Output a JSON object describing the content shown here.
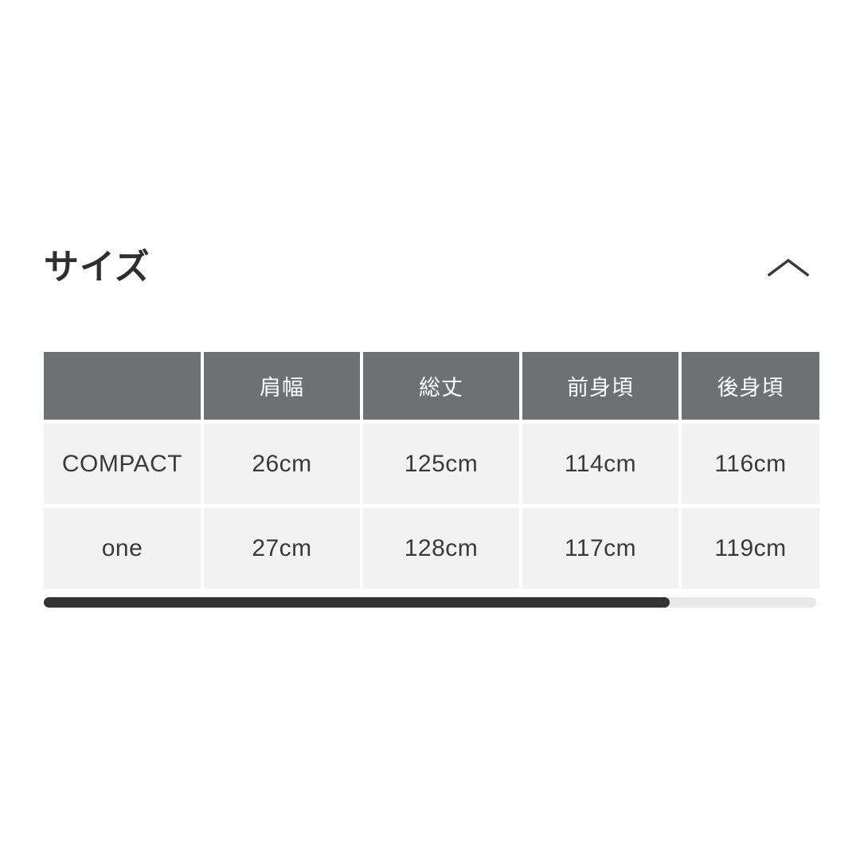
{
  "section": {
    "title": "サイズ",
    "toggle_icon": "chevron-up-icon",
    "expanded": true
  },
  "colors": {
    "page_background": "#ffffff",
    "header_cell_background": "#6f7071",
    "header_cell_text": "#ffffff",
    "body_cell_background": "#f2f2f2",
    "body_cell_text": "#3a3a3a",
    "title_text": "#2e2e2e",
    "scrollbar_track": "#e8e8e8",
    "scrollbar_thumb": "#333333"
  },
  "size_table": {
    "columns": [
      "",
      "肩幅",
      "総丈",
      "前身頃",
      "後身頃"
    ],
    "rows": [
      {
        "size": "COMPACT",
        "values": [
          "26cm",
          "125cm",
          "114cm",
          "116cm"
        ]
      },
      {
        "size": "one",
        "values": [
          "27cm",
          "128cm",
          "117cm",
          "119cm"
        ]
      }
    ]
  },
  "scrollbar": {
    "orientation": "horizontal",
    "thumb_percent": 81,
    "position_percent": 0
  }
}
